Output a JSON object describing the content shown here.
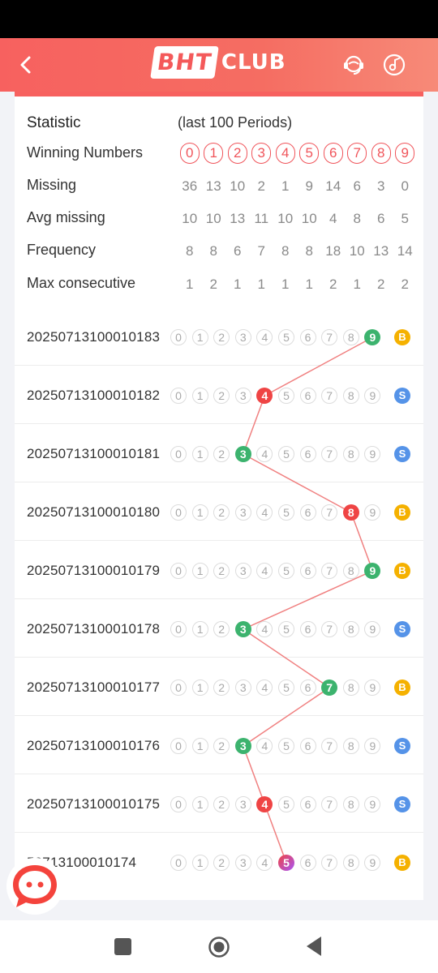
{
  "header": {
    "logo_bht": "BHT",
    "logo_club": "CLUB"
  },
  "stats": {
    "title": "Statistic",
    "subtitle": "(last 100 Periods)",
    "winning_label": "Winning Numbers",
    "winning_numbers": [
      "0",
      "1",
      "2",
      "3",
      "4",
      "5",
      "6",
      "7",
      "8",
      "9"
    ],
    "missing_label": "Missing",
    "missing": [
      "36",
      "13",
      "10",
      "2",
      "1",
      "9",
      "14",
      "6",
      "3",
      "0"
    ],
    "avg_label": "Avg missing",
    "avg_missing": [
      "10",
      "10",
      "13",
      "11",
      "10",
      "10",
      "4",
      "8",
      "6",
      "5"
    ],
    "freq_label": "Frequency",
    "frequency": [
      "8",
      "8",
      "6",
      "7",
      "8",
      "8",
      "18",
      "10",
      "13",
      "14"
    ],
    "maxcons_label": "Max consecutive",
    "max_consecutive": [
      "1",
      "2",
      "1",
      "1",
      "1",
      "1",
      "2",
      "1",
      "2",
      "2"
    ]
  },
  "history": [
    {
      "period": "20250713100010183",
      "number": 9,
      "size": "B",
      "style": "green"
    },
    {
      "period": "20250713100010182",
      "number": 4,
      "size": "S",
      "style": "red"
    },
    {
      "period": "20250713100010181",
      "number": 3,
      "size": "S",
      "style": "green"
    },
    {
      "period": "20250713100010180",
      "number": 8,
      "size": "B",
      "style": "red"
    },
    {
      "period": "20250713100010179",
      "number": 9,
      "size": "B",
      "style": "green"
    },
    {
      "period": "20250713100010178",
      "number": 3,
      "size": "S",
      "style": "green"
    },
    {
      "period": "20250713100010177",
      "number": 7,
      "size": "B",
      "style": "green"
    },
    {
      "period": "20250713100010176",
      "number": 3,
      "size": "S",
      "style": "green"
    },
    {
      "period": "20250713100010175",
      "number": 4,
      "size": "S",
      "style": "red"
    },
    {
      "period": "50713100010174",
      "number": 5,
      "size": "B",
      "style": "grad"
    }
  ],
  "digits": [
    "0",
    "1",
    "2",
    "3",
    "4",
    "5",
    "6",
    "7",
    "8",
    "9"
  ],
  "colors": {
    "brand": "#f7615f",
    "green": "#3cb36e",
    "red": "#ef4444",
    "big": "#f5b100",
    "small": "#5593e8",
    "trend_line": "#f08080"
  },
  "icons": [
    "back-arrow-icon",
    "support-agent-icon",
    "music-icon",
    "chat-icon",
    "recents-icon",
    "home-icon",
    "back-icon"
  ]
}
